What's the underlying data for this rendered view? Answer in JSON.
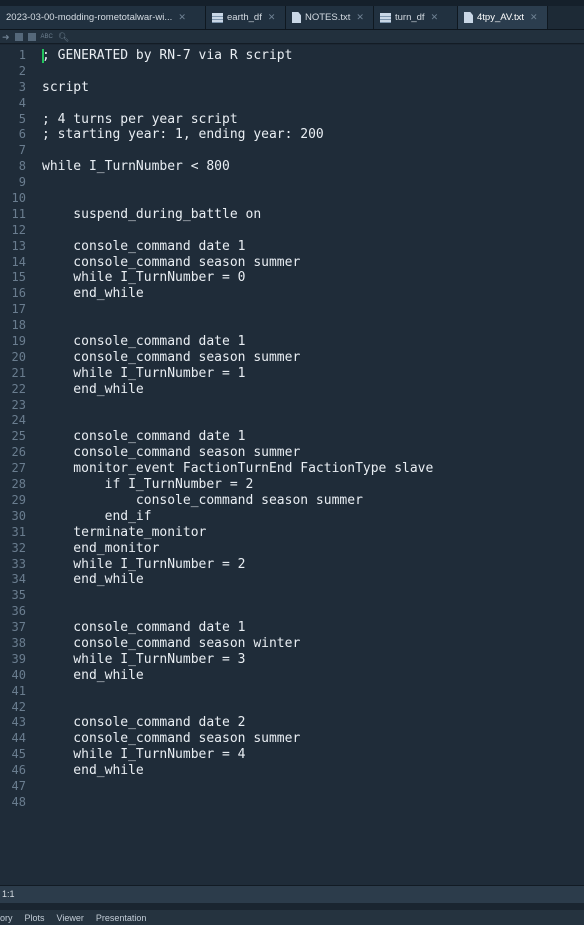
{
  "tabs": [
    {
      "label": "2023-03-00-modding-rometotalwar-wi...",
      "icon": "none"
    },
    {
      "label": "earth_df",
      "icon": "data-grid-icon"
    },
    {
      "label": "NOTES.txt",
      "icon": "document-icon"
    },
    {
      "label": "turn_df",
      "icon": "data-grid-icon"
    },
    {
      "label": "4tpy_AV.txt",
      "icon": "document-icon",
      "active": true
    }
  ],
  "toolbar": {
    "abc_label": "ABC"
  },
  "editor": {
    "lines": [
      {
        "n": "1",
        "t": "; GENERATED by RN-7 via R script"
      },
      {
        "n": "2",
        "t": ""
      },
      {
        "n": "3",
        "t": "script"
      },
      {
        "n": "4",
        "t": ""
      },
      {
        "n": "5",
        "t": "; 4 turns per year script"
      },
      {
        "n": "6",
        "t": "; starting year: 1, ending year: 200"
      },
      {
        "n": "7",
        "t": ""
      },
      {
        "n": "8",
        "t": "while I_TurnNumber < 800"
      },
      {
        "n": "9",
        "t": ""
      },
      {
        "n": "10",
        "t": ""
      },
      {
        "n": "11",
        "t": "    suspend_during_battle on"
      },
      {
        "n": "12",
        "t": ""
      },
      {
        "n": "13",
        "t": "    console_command date 1"
      },
      {
        "n": "14",
        "t": "    console_command season summer"
      },
      {
        "n": "15",
        "t": "    while I_TurnNumber = 0"
      },
      {
        "n": "16",
        "t": "    end_while"
      },
      {
        "n": "17",
        "t": ""
      },
      {
        "n": "18",
        "t": ""
      },
      {
        "n": "19",
        "t": "    console_command date 1"
      },
      {
        "n": "20",
        "t": "    console_command season summer"
      },
      {
        "n": "21",
        "t": "    while I_TurnNumber = 1"
      },
      {
        "n": "22",
        "t": "    end_while"
      },
      {
        "n": "23",
        "t": ""
      },
      {
        "n": "24",
        "t": ""
      },
      {
        "n": "25",
        "t": "    console_command date 1"
      },
      {
        "n": "26",
        "t": "    console_command season summer"
      },
      {
        "n": "27",
        "t": "    monitor_event FactionTurnEnd FactionType slave"
      },
      {
        "n": "28",
        "t": "        if I_TurnNumber = 2"
      },
      {
        "n": "29",
        "t": "            console_command season summer"
      },
      {
        "n": "30",
        "t": "        end_if"
      },
      {
        "n": "31",
        "t": "    terminate_monitor"
      },
      {
        "n": "32",
        "t": "    end_monitor"
      },
      {
        "n": "33",
        "t": "    while I_TurnNumber = 2"
      },
      {
        "n": "34",
        "t": "    end_while"
      },
      {
        "n": "35",
        "t": ""
      },
      {
        "n": "36",
        "t": ""
      },
      {
        "n": "37",
        "t": "    console_command date 1"
      },
      {
        "n": "38",
        "t": "    console_command season winter"
      },
      {
        "n": "39",
        "t": "    while I_TurnNumber = 3"
      },
      {
        "n": "40",
        "t": "    end_while"
      },
      {
        "n": "41",
        "t": ""
      },
      {
        "n": "42",
        "t": ""
      },
      {
        "n": "43",
        "t": "    console_command date 2"
      },
      {
        "n": "44",
        "t": "    console_command season summer"
      },
      {
        "n": "45",
        "t": "    while I_TurnNumber = 4"
      },
      {
        "n": "46",
        "t": "    end_while"
      },
      {
        "n": "47",
        "t": ""
      },
      {
        "n": "48",
        "t": ""
      }
    ]
  },
  "status": {
    "position": "1:1"
  },
  "panes": {
    "tabs": [
      "ory",
      "Plots",
      "Viewer",
      "Presentation"
    ]
  }
}
